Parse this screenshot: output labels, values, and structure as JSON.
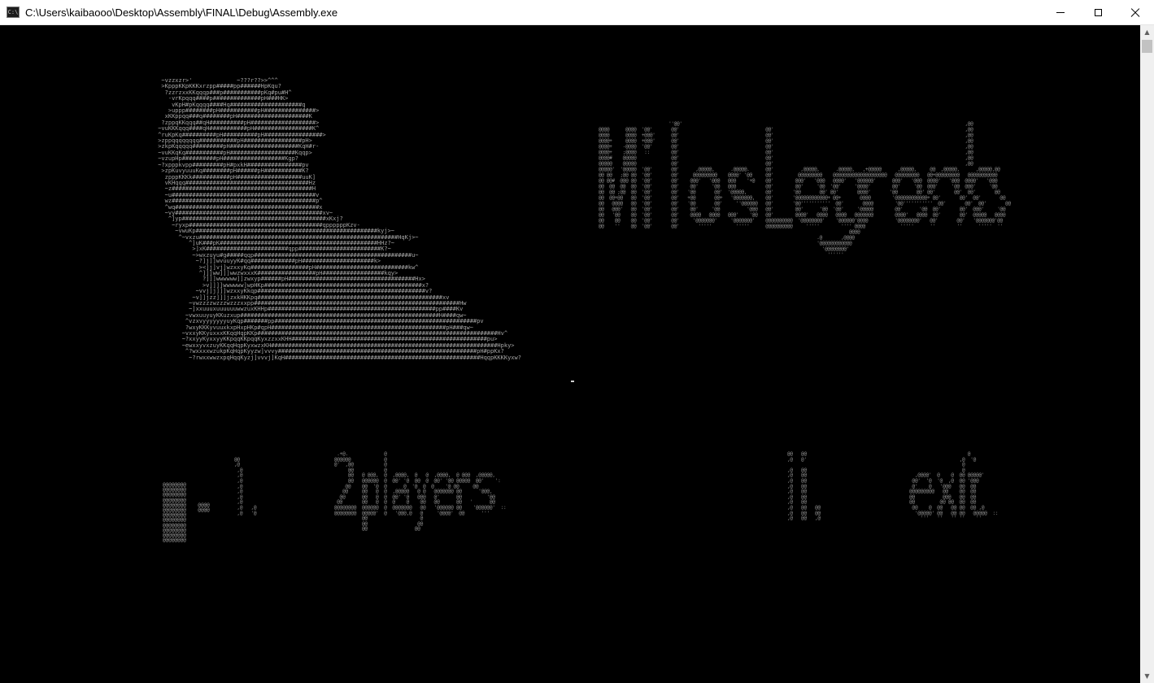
{
  "window": {
    "title": "C:\\Users\\kaibaooo\\Desktop\\Assembly\\FINAL\\Debug\\Assembly.exe",
    "icon": "console-app-icon",
    "icon_glyph": "C:\\",
    "controls": {
      "minimize_icon": "minimize-icon",
      "maximize_icon": "maximize-icon",
      "close_icon": "close-icon"
    }
  },
  "scrollbar": {
    "up_arrow": "▲",
    "down_arrow": "▼"
  },
  "console": {
    "portrait_art": "  ~vzzxzr>'             ~???r??>>^^^\n  >KpppKKpKKKxrzpp#####pp######HpKqu?\n   ?zzrzxxKKqqqp###p###########pKq#pu#H^\n    -vrKpqqq####p##############pH###HK>\n     vKpH#pKqqqq####Hq#####################q\n    >uppp########pH###########pH###############>\n   xKKppqq###q########pH#####################K\n  ?zppqKKqqq##qH##########pH###################>\n ~vuKKKqqq####qH###########pH#################K^\n ^ruKpKq##########pH##########pH#################>\n >zppqqqqqqqq###########pH#################pH>\n >zkpKqqqqq#########pH####################KqH#r-\n ~vuKKqKq###########pH###################Kqqp>\n ~vzupHp##########pH##################Kgp?\n ~?xpppkvpp#########pH#pxkH################pv\n  >zpKuvyuuuKq########pH######pH###########K?\n   zpppKKKk###########pH###################uuK]\n   vKHqqq####################################Hz\n   ~z#########################################H\n   ~u##########################################v\n   wz##########################################p^\n   ^wq##########################################x\n   ~vy###########################################xv~\n    ^]yp##########################################xKxj?\n     ~ryxp#######################################qppppppKzv-\n      ~vwuKp#####################################################kyj>~\n       ^~vxzu##########################################################HqKj>~\n          ^]uK###pK##############################################HHz?~\n           >]xK########################qpp########################K?~\n           ~>wxzuyu#g#####qqp##############################################u~\n            ~?]j]]wvuuyyK#qq#############pH#####################k>\n             ><]j]vj]wzxxyKq#################pH###########################kw^\n             ^]]]ww]]]wwzwxxxK#################pH##################kqy>\n              ?]]]wwwwww]]zwxyp######pH#####################################Hx>\n              >v]]]]wwwwww]wpHKp##############################################x?\n            ~vvj]j]]]wzxxyKkqp#################################################v?\n           ~v]]jzz]]]jzxkHKKpq######################################################xv\n          ~vwzzzzwzzzwzzzxxpp############################################################Hw\n          ~]xxuuuxuuuuuuwwzuxKHHp#################################################pp####Kv\n         ~vwxuuyuyKKuzxup##########################################################H####qw~\n         ^vzxvyyyyyyyuyKqp#######pp###########################################################pv\n         ?wxyKKKyvuuxkxpHxpHKp#qpH###################################################pH###qw~\n        ~vxxyKKyuxxxKKqqHqpKKp######################################################################Hv^\n        ~?xxyyKyxxyyKKpqqKKpqqKyxzzxxKHH#########################################################pu>\n        ~ewxxyvxzuyKKqqHqpKyxwzxKH##################################################################Hpky>\n         ^?wxxxxwzukpKqHqpKyyzw]vvvy##########################################################pH#ppKx?\n          ~?rwxxwwzxpqHqqKyzj]vvvj]KqH#########################################################HqqpKKKKyxw?",
    "logo_art": "                          ''@@'                                                                                                         ,@@\n@@@@      @@@@  '@@'       @@'                                @@'                                                                       ,@@\n@@@@      @@@@  +@@@'      @@'                                @@'                                                                       ,@@\n@@@@+     @@@@  +@@@'      @@'                                @@'                                                                       ,@@\n@@@@+    -@@@@  '@@'       @@'                                @@'                                                                       ,@@\n@@@@+    ;@@@@   ::        @@'                                @@'                                                                       ,@@\n@@@@#    @@@@@             @@'                                @@'                                                                       ,@@\n@@@@@    @@@@@             @@'                                @@'                                                                       ,@@\n@@@@@'  '@@@@@  '@@'       @@'      ,@@@@@,      .@@@@@.      @@'          ,@@@@@,      .@@@@@,   ,+@@@@@      ,@@@@@,     @@  ,@@@@@,      ,@@@@@,@@\n@@ @@   ;@@ @@  '@@'       @@'     @@@@@@@@@    @@@@' '@@     @@'         @@@@@@@@@    @@@@@@@@@@@@@@@@@@@@   @@@@@@@@@   @@+@@@@@@@@@   @@@@@@@@@@@\n@@ @@#  @@@ @@  '@@'       @@'    @@@'   '@@@   @@@    '+@    @@'        @@@'   '@@@   @@@@'   '@@@@@@'      @@@'   '@@@  @@@@'   '@@@  @@@@'   '@@@\n@@  @@  @@  @@  '@@'       @@'    @@'     '@@   @@@           @@'        @@'     '@@  '@@'     '@@@@'        @@'     '@@  @@@'     '@@  @@@'     '@@\n@@  @@ ;@@  @@  '@@'       @@'   '@@       @@'  '@@@@@,       @@'       '@@       @@' @@'       @@@@'       '@@       @@' @@'       @@'  @@'       @@\n@@  @@+@@   @@  '@@'       @@'   +@@       @@+   '@@@@@@@,    @@'       '@@@@@@@@@@@@+ @@+       @@@@        '@@@@@@@@@@@@+ @@'       @@'  @@'       @@\n@@   @@@@   @@  '@@'       @@'   '@@       @@'     ''@@@@@@   @@'       '@@'''''''''''  @@'       @@@@        '@@'''''''''''  @@'       @@'  @@'       @@\n@@   @@@'   @@  '@@'       @@'    @@'     '@@          '@@@   @@'        @@'      '@@  '@@'     '@@@@@        @@'      '@@  @@'       @@'  @@@'     '@@\n@@   '@@    @@  '@@'       @@'    @@@@   @@@@   @@@'    '@@   @@'        @@@@'   @@@@   @@@@   @@@@@@@        @@@@'   @@@@  @@'       @@'  @@@@@   @@@@\n@@    @@    @@  '@@'       @@'     '@@@@@@@'     '@@@@@@@'    @@@@@@@@@@  '@@@@@@@@'    '@@@@@@'@@@@          '@@@@@@@@'   @@'       @@'   '@@@@@@@'@@\n@@    ''    @@  '@@'       @@'       '''''         '''''      @@@@@@@@@@     '''''        '''' @@@@             '''''      ''        ''      '''''  ''\n                                                                                             @@@@\n                                                                                 .@       ,@@@@\n                                                                                 '@@@@@@@@@@@@\n                                                                                   '@@@@@@@@'\n                                                                                     ''''''",
    "selector_art": "@@@@@@@@\n@@@@@@@@\n@@@@@@@@\n@@@@@@@@\n@@@@@@@@    @@@@\n@@@@@@@@    @@@@\n@@@@@@@@\n@@@@@@@@\n@@@@@@@@\n@@@@@@@@\n@@@@@@@@\n@@@@@@@@",
    "menu_option_1_art": "                                     .+@.             @\n@@                                  @@@@@@            @\n,@                                  @'  ,@@           @\n ,@                                      @@           @\n ,@                                      @@   @ @@@,  @  ,@@@@,  @   @  ,@@@@,  @ @@@  ,@@@@@,\n ,@                                      @@   @@@@@@  @  @@' '@  @@  @  @@' '@@ @@@@@  @@'    ':\n ,@                                     @@    @@  '@  @      @  '@  @  @    '@ @@     @@\n ,@                                    @@     @@   @  @  ,@@@@@   @ @   @@@@@@@ @@      '@@@,\n ,@                                   @@      @@   @  @  @@' '@   @@@   @'      @@         '@@\n ,@                                  @@       @@   @  @  @    @    @@   @@      @@   '      @@\n ,@   ,@                            @@@@@@@@  @@@@@@  @  @@@@@@@   @@   '@@@@@@ @@    '@@@@@@'  ::\n ,@   '@                            @@@@@@@@  @@@@@'  @   '@@@,@   @     '@@@@'  @@      '''\n                                              @@                   @\n                                              @@                  @@\n                                              @@                 @@",
    "menu_option_2_art": "@@   @@                                                          @\n,@   @'                                                       ,@  '@\n                                                               @\n,@   @@                                                        @\n,@   @@                                       ,@@@@'  @    @  @@ @@@@@'\n,@   @@                                      @@'  '@  '@  ,@  @@ '@@@\n,@   @@                                      @'    @   '@@@   @@  @@\n,@   @@                                     @@@@@@@@@   @@    @@  @@\n,@   @@                                     @@          @@@   @@  @@\n,@   @@                                     @@         @@ @@  @@  @@\n,@   @@   @@                                 @@    @  @@   @@ @@  @@ ,@\n,@   @@   @@                                  '@@@@@' @@   @@ @@   @@@@@  ::\n,@   @@   ,@                                    '''   ''   '' ''    ''"
  }
}
